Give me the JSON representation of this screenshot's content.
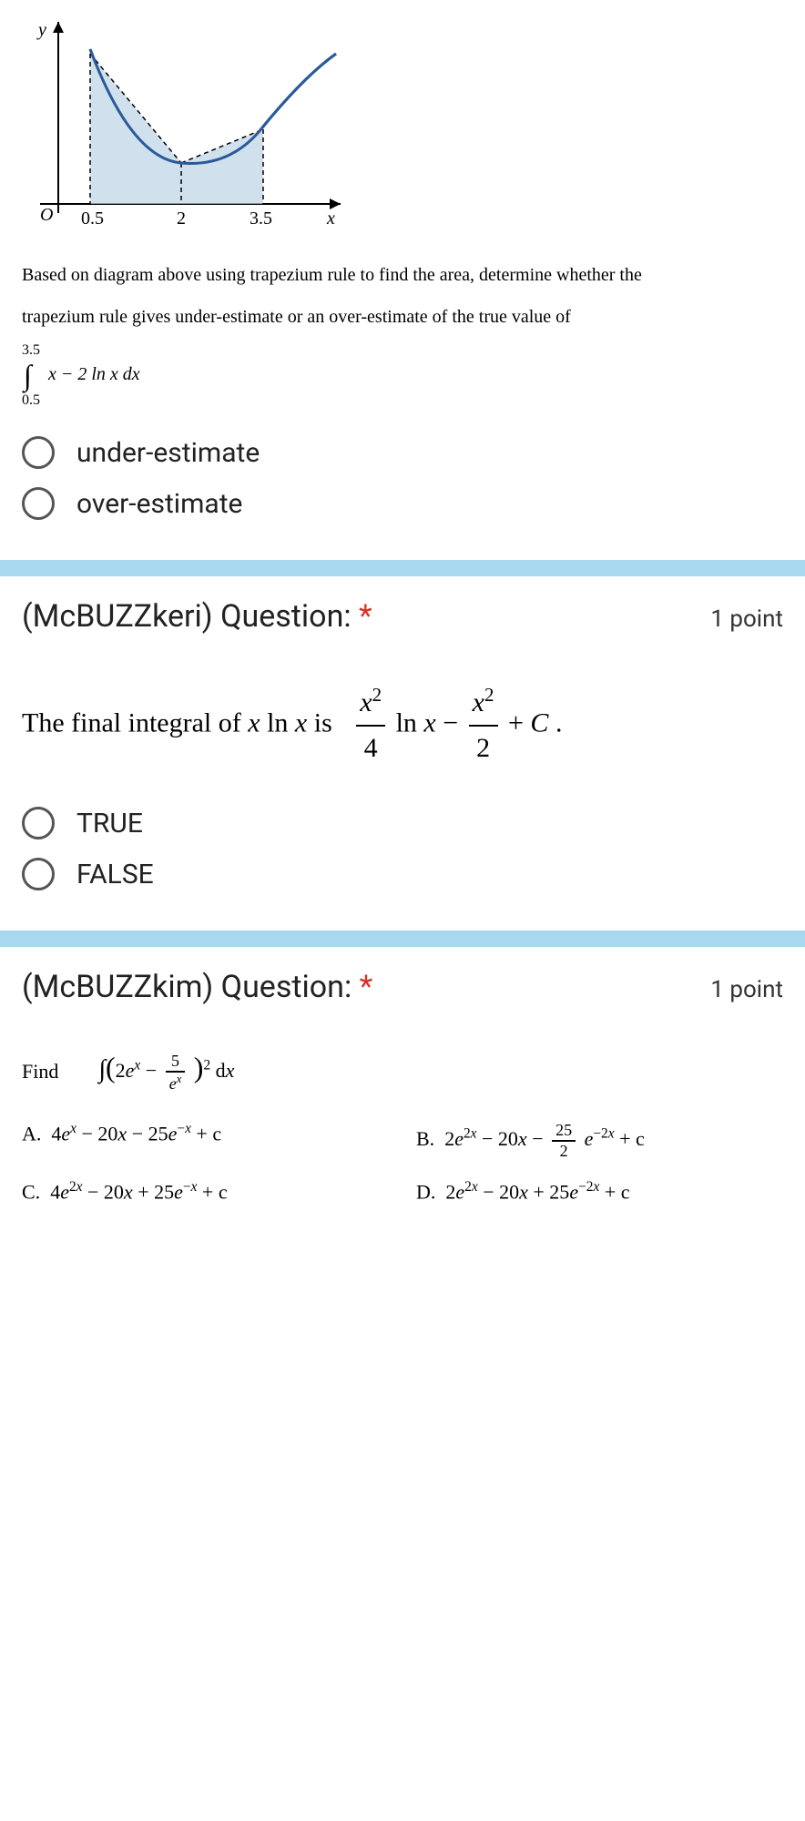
{
  "chart_data": {
    "type": "area",
    "title": "",
    "xlabel": "x",
    "ylabel": "y",
    "x_ticks": [
      0.5,
      2,
      3.5
    ],
    "function_description": "x - 2 ln x",
    "trapezium_x": [
      0.5,
      2,
      3.5
    ],
    "shaded_region": true,
    "xlim": [
      0,
      5
    ],
    "ylim": [
      0,
      4
    ]
  },
  "q1": {
    "prompt_line1": "Based on diagram above using trapezium rule to find the area, determine whether the",
    "prompt_line2": "trapezium rule gives under-estimate or an over-estimate of the true value of",
    "integral_upper": "3.5",
    "integral_lower": "0.5",
    "integral_expr": "x − 2 ln x  dx",
    "options": {
      "a": "under-estimate",
      "b": "over-estimate"
    }
  },
  "q2": {
    "title": "(McBUZZkeri) Question:",
    "required": "*",
    "points": "1 point",
    "statement_prefix": "The final integral of ",
    "statement_mid": "x ln x is",
    "options": {
      "a": "TRUE",
      "b": "FALSE"
    }
  },
  "q3": {
    "title": "(McBUZZkim) Question:",
    "required": "*",
    "points": "1 point",
    "find_label": "Find",
    "answers": {
      "a_label": "A.",
      "b_label": "B.",
      "c_label": "C.",
      "d_label": "D."
    }
  }
}
